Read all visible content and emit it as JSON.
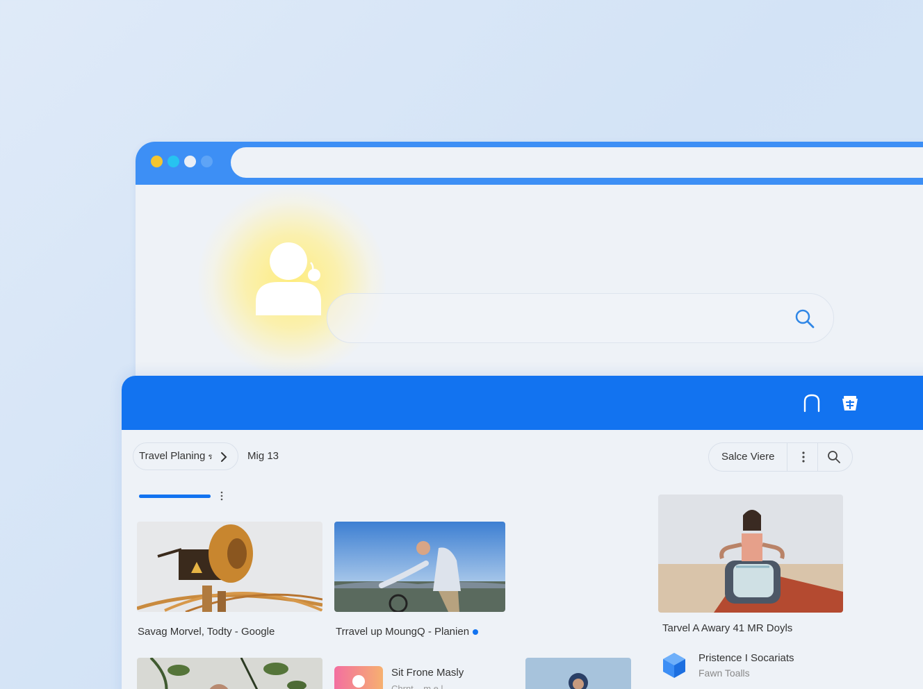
{
  "colors": {
    "accent": "#1273f0",
    "titlebar": "#3d8ff5",
    "dot_1": "#f4c531",
    "dot_2": "#27c3f0",
    "dot_3": "#e9eef6",
    "dot_4": "#5ea4f6"
  },
  "icons": {
    "avatar": "person-avatar-icon",
    "big_search": "search-icon",
    "header_home": "home-icon",
    "header_basket": "basket-icon",
    "crumb_chevron": "chevron-right-icon",
    "tool_more": "more-vertical-icon",
    "tool_search": "search-icon"
  },
  "breadcrumb": {
    "current": "Travel Planing",
    "glyph": "ร",
    "next": "Mig 13"
  },
  "toolbar": {
    "label": "Salce Viere"
  },
  "progress": {
    "value": 1.0
  },
  "cards": [
    {
      "title": "Savag Morvel, Todty - Google"
    },
    {
      "title": "Trravel up MoungQ - Planien"
    },
    {
      "title": "Tarvel A Awary 41 MR Doyls"
    }
  ],
  "list_item": {
    "title": "Sit Frone Masly",
    "subtitle": "Chrnt... m.e.l..."
  },
  "side_item": {
    "title": "Pristence I Socariats",
    "subtitle": "Fawn Toalls"
  }
}
